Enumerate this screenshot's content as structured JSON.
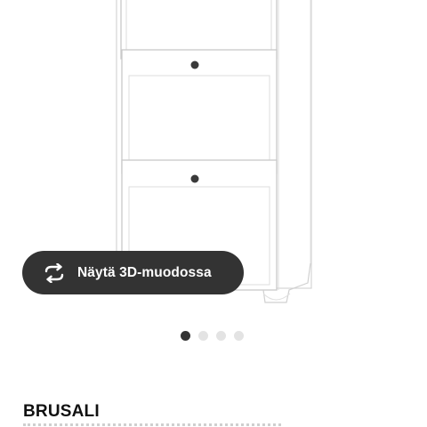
{
  "view_3d_button": {
    "label": "Näytä 3D-muodossa",
    "icon": "rotate-3d-icon"
  },
  "carousel": {
    "total": 4,
    "active_index": 0
  },
  "product": {
    "name": "BRUSALI"
  },
  "colors": {
    "button_bg": "#333333",
    "dot_active": "#333333",
    "dot_inactive": "#e3e3e3"
  }
}
